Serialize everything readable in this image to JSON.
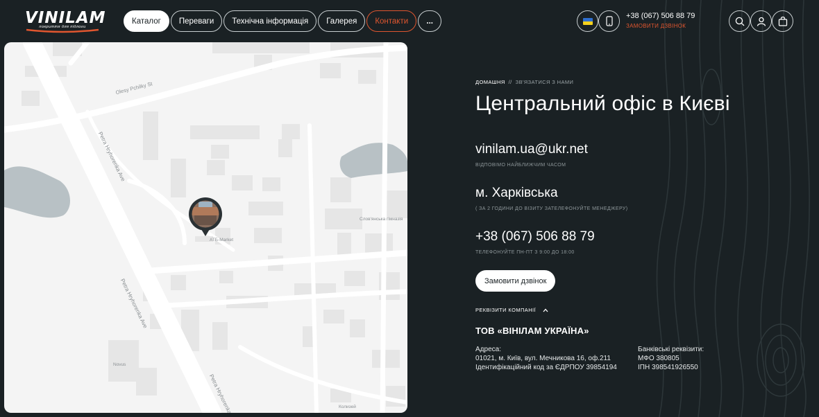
{
  "logo": {
    "word": "VINILAM",
    "tagline": "покриття для підлоги"
  },
  "nav": {
    "items": [
      {
        "label": "Каталог",
        "state": "active"
      },
      {
        "label": "Переваги",
        "state": ""
      },
      {
        "label": "Технічна інформація",
        "state": ""
      },
      {
        "label": "Галерея",
        "state": ""
      },
      {
        "label": "Контакти",
        "state": "accent"
      }
    ],
    "more_label": "..."
  },
  "header": {
    "phone": "+38 (067) 506 88 79",
    "callback_label": "ЗАМОВИТИ ДЗВІНОК",
    "flag_colors": [
      "#2f6fd0",
      "#f6d21d"
    ]
  },
  "map": {
    "streets": [
      "Olesy Pchilky St",
      "Petra Hryhorenka Ave",
      "Petra Hryhorenka Ave",
      "Petra Hryhorenka"
    ],
    "pois": [
      "АТБ-Market",
      "Слов'янська гімназія",
      "Novus",
      "Колизей"
    ]
  },
  "breadcrumb": {
    "home": "ДОМАШНЯ",
    "separator": "//",
    "current": "ЗВ'ЯЗАТИСЯ З НАМИ"
  },
  "title": "Центральний офіс в Києві",
  "email": {
    "value": "vinilam.ua@ukr.net",
    "note": "ВІДПОВІМО НАЙБЛИЖЧИМ ЧАСОМ"
  },
  "address": {
    "value": "м. Харківська",
    "note": "( ЗА 2 ГОДИНИ ДО ВІЗИТУ ЗАТЕЛЕФОНУЙТЕ МЕНЕДЖЕРУ)"
  },
  "phone": {
    "value": "+38 (067) 506 88 79",
    "note": "ТЕЛЕФОНУЙТЕ ПН-ПТ  З 9:00 ДО 18:00"
  },
  "callback_button": "Замовити дзвінок",
  "requisites": {
    "toggle_label": "РЕКВІЗИТИ КОМПАНІЇ",
    "company": "ТОВ «ВІНІЛАМ УКРАЇНА»",
    "left": {
      "heading": "Адреса:",
      "line1": "01021, м. Київ, вул. Мечникова 16, оф.211",
      "line2": "Ідентифікаційний код за ЄДРПОУ 39854194"
    },
    "right": {
      "heading": "Банківські реквізити:",
      "line1": "МФО 380805",
      "line2": "ІПН 398541926550"
    }
  },
  "colors": {
    "background": "#1a2124",
    "accent": "#e0562f",
    "map_bg": "#f4f4f4"
  }
}
